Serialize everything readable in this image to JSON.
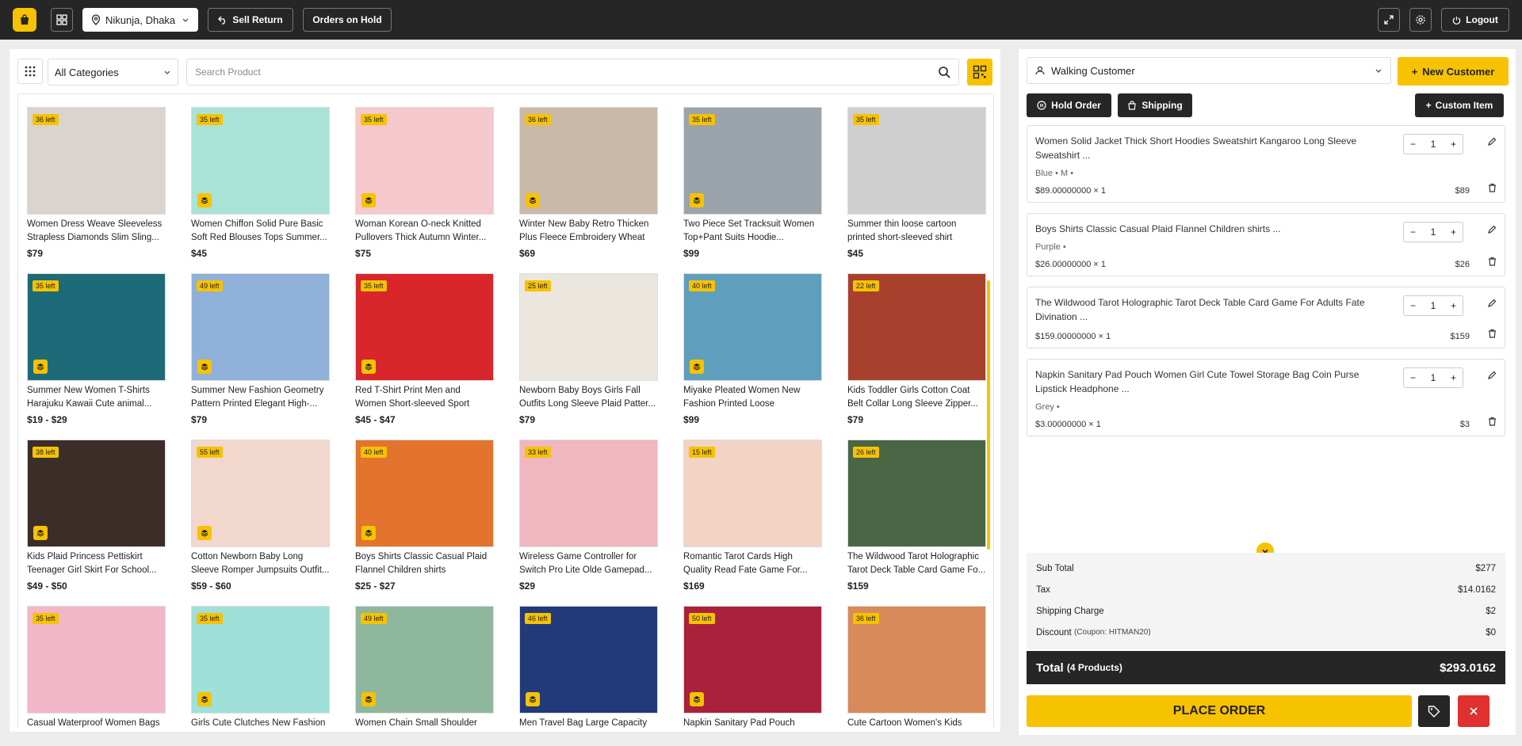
{
  "topbar": {
    "location": "Nikunja, Dhaka",
    "sell_return": "Sell Return",
    "orders_on_hold": "Orders on Hold",
    "logout": "Logout"
  },
  "filters": {
    "category": "All Categories",
    "search_placeholder": "Search Product"
  },
  "products": [
    {
      "name": "Women Dress Weave Sleeveless Strapless Diamonds Slim Sling...",
      "price": "$79",
      "stock": "36 left",
      "variant": false,
      "color": "#d9d4cf"
    },
    {
      "name": "Women Chiffon Solid Pure Basic Soft Red Blouses Tops Summer...",
      "price": "$45",
      "stock": "35 left",
      "variant": true,
      "color": "#a9e3d8"
    },
    {
      "name": "Woman Korean O-neck Knitted Pullovers Thick Autumn Winter...",
      "price": "$75",
      "stock": "35 left",
      "variant": true,
      "color": "#f4c8cc"
    },
    {
      "name": "Winter New Baby Retro Thicken Plus Fleece Embroidery Wheat",
      "price": "$69",
      "stock": "36 left",
      "variant": true,
      "color": "#c9b9a8"
    },
    {
      "name": "Two Piece Set Tracksuit Women Top+Pant Suits Hoodie...",
      "price": "$99",
      "stock": "35 left",
      "variant": true,
      "color": "#9ba3ab"
    },
    {
      "name": "Summer thin loose cartoon printed short-sleeved shirt",
      "price": "$45",
      "stock": "35 left",
      "variant": false,
      "color": "#cfcfcf"
    },
    {
      "name": "Summer New Women T-Shirts Harajuku Kawaii Cute animal...",
      "price": "$19 - $29",
      "stock": "35 left",
      "variant": true,
      "color": "#1d6b78"
    },
    {
      "name": "Summer New Fashion Geometry Pattern Printed Elegant High-...",
      "price": "$79",
      "stock": "49 left",
      "variant": true,
      "color": "#8fb0d8"
    },
    {
      "name": "Red T-Shirt Print Men and Women Short-sleeved Sport Fashion...",
      "price": "$45 - $47",
      "stock": "35 left",
      "variant": true,
      "color": "#d8262a"
    },
    {
      "name": "Newborn Baby Boys Girls Fall Outfits Long Sleeve Plaid Patter...",
      "price": "$79",
      "stock": "25 left",
      "variant": false,
      "color": "#ebe7df"
    },
    {
      "name": "Miyake Pleated Women New Fashion Printed Loose",
      "price": "$99",
      "stock": "40 left",
      "variant": true,
      "color": "#5f9fbd"
    },
    {
      "name": "Kids Toddler Girls Cotton Coat Belt Collar Long Sleeve Zipper...",
      "price": "$79",
      "stock": "22 left",
      "variant": false,
      "color": "#a8402e"
    },
    {
      "name": "Kids Plaid Princess Pettiskirt Teenager Girl Skirt For School...",
      "price": "$49 - $50",
      "stock": "38 left",
      "variant": true,
      "color": "#3b2e29"
    },
    {
      "name": "Cotton Newborn Baby Long Sleeve Romper Jumpsuits Outfit...",
      "price": "$59 - $60",
      "stock": "55 left",
      "variant": true,
      "color": "#f1d7cc"
    },
    {
      "name": "Boys Shirts Classic Casual Plaid Flannel Children shirts",
      "price": "$25 - $27",
      "stock": "40 left",
      "variant": true,
      "color": "#e2742e"
    },
    {
      "name": "Wireless Game Controller for Switch Pro Lite Olde Gamepad...",
      "price": "$29",
      "stock": "33 left",
      "variant": false,
      "color": "#f0b7bf"
    },
    {
      "name": "Romantic Tarot Cards High Quality Read Fate Game For...",
      "price": "$169",
      "stock": "15 left",
      "variant": false,
      "color": "#f2d3c4"
    },
    {
      "name": "The Wildwood Tarot Holographic Tarot Deck Table Card Game Fo...",
      "price": "$159",
      "stock": "26 left",
      "variant": false,
      "color": "#4a6645"
    },
    {
      "name": "Casual Waterproof Women Bags",
      "price": "",
      "stock": "35 left",
      "variant": false,
      "color": "#f1b7c8"
    },
    {
      "name": "Girls Cute Clutches New Fashion",
      "price": "",
      "stock": "35 left",
      "variant": true,
      "color": "#9fe0d8"
    },
    {
      "name": "Women Chain Small Shoulder",
      "price": "",
      "stock": "49 left",
      "variant": true,
      "color": "#8fb79d"
    },
    {
      "name": "Men Travel Bag Large Capacity",
      "price": "",
      "stock": "46 left",
      "variant": true,
      "color": "#223a7a"
    },
    {
      "name": "Napkin Sanitary Pad Pouch",
      "price": "",
      "stock": "50 left",
      "variant": true,
      "color": "#a9213a"
    },
    {
      "name": "Cute Cartoon Women's Kids",
      "price": "",
      "stock": "36 left",
      "variant": false,
      "color": "#d88a5a"
    }
  ],
  "cart": {
    "customer": "Walking Customer",
    "new_customer": "New Customer",
    "hold_order": "Hold Order",
    "shipping": "Shipping",
    "custom_item": "Custom Item",
    "items": [
      {
        "name": "Women Solid Jacket Thick Short Hoodies Sweatshirt Kangaroo Long Sleeve Sweatshirt ...",
        "variant": "Blue • M •",
        "qty": "1",
        "unit": "$89.00000000 × 1",
        "total": "$89"
      },
      {
        "name": "Boys Shirts Classic Casual Plaid Flannel Children shirts ...",
        "variant": "Purple •",
        "qty": "1",
        "unit": "$26.00000000 × 1",
        "total": "$26"
      },
      {
        "name": "The Wildwood Tarot Holographic Tarot Deck Table Card Game For Adults Fate Divination ...",
        "variant": "",
        "qty": "1",
        "unit": "$159.00000000 × 1",
        "total": "$159"
      },
      {
        "name": "Napkin Sanitary Pad Pouch Women Girl Cute Towel Storage Bag Coin Purse Lipstick Headphone ...",
        "variant": "Grey •",
        "qty": "1",
        "unit": "$3.00000000 × 1",
        "total": "$3"
      }
    ],
    "summary": {
      "subtotal_label": "Sub Total",
      "subtotal": "$277",
      "tax_label": "Tax",
      "tax": "$14.0162",
      "shipping_label": "Shipping Charge",
      "shipping": "$2",
      "discount_label": "Discount",
      "coupon": "(Coupon: HITMAN20)",
      "discount": "$0",
      "total_label": "Total",
      "total_count": "(4 Products)",
      "total": "$293.0162"
    },
    "place_order": "PLACE ORDER"
  },
  "colors": {
    "accent": "#f7c200",
    "dark": "#262626",
    "danger": "#e03030"
  }
}
